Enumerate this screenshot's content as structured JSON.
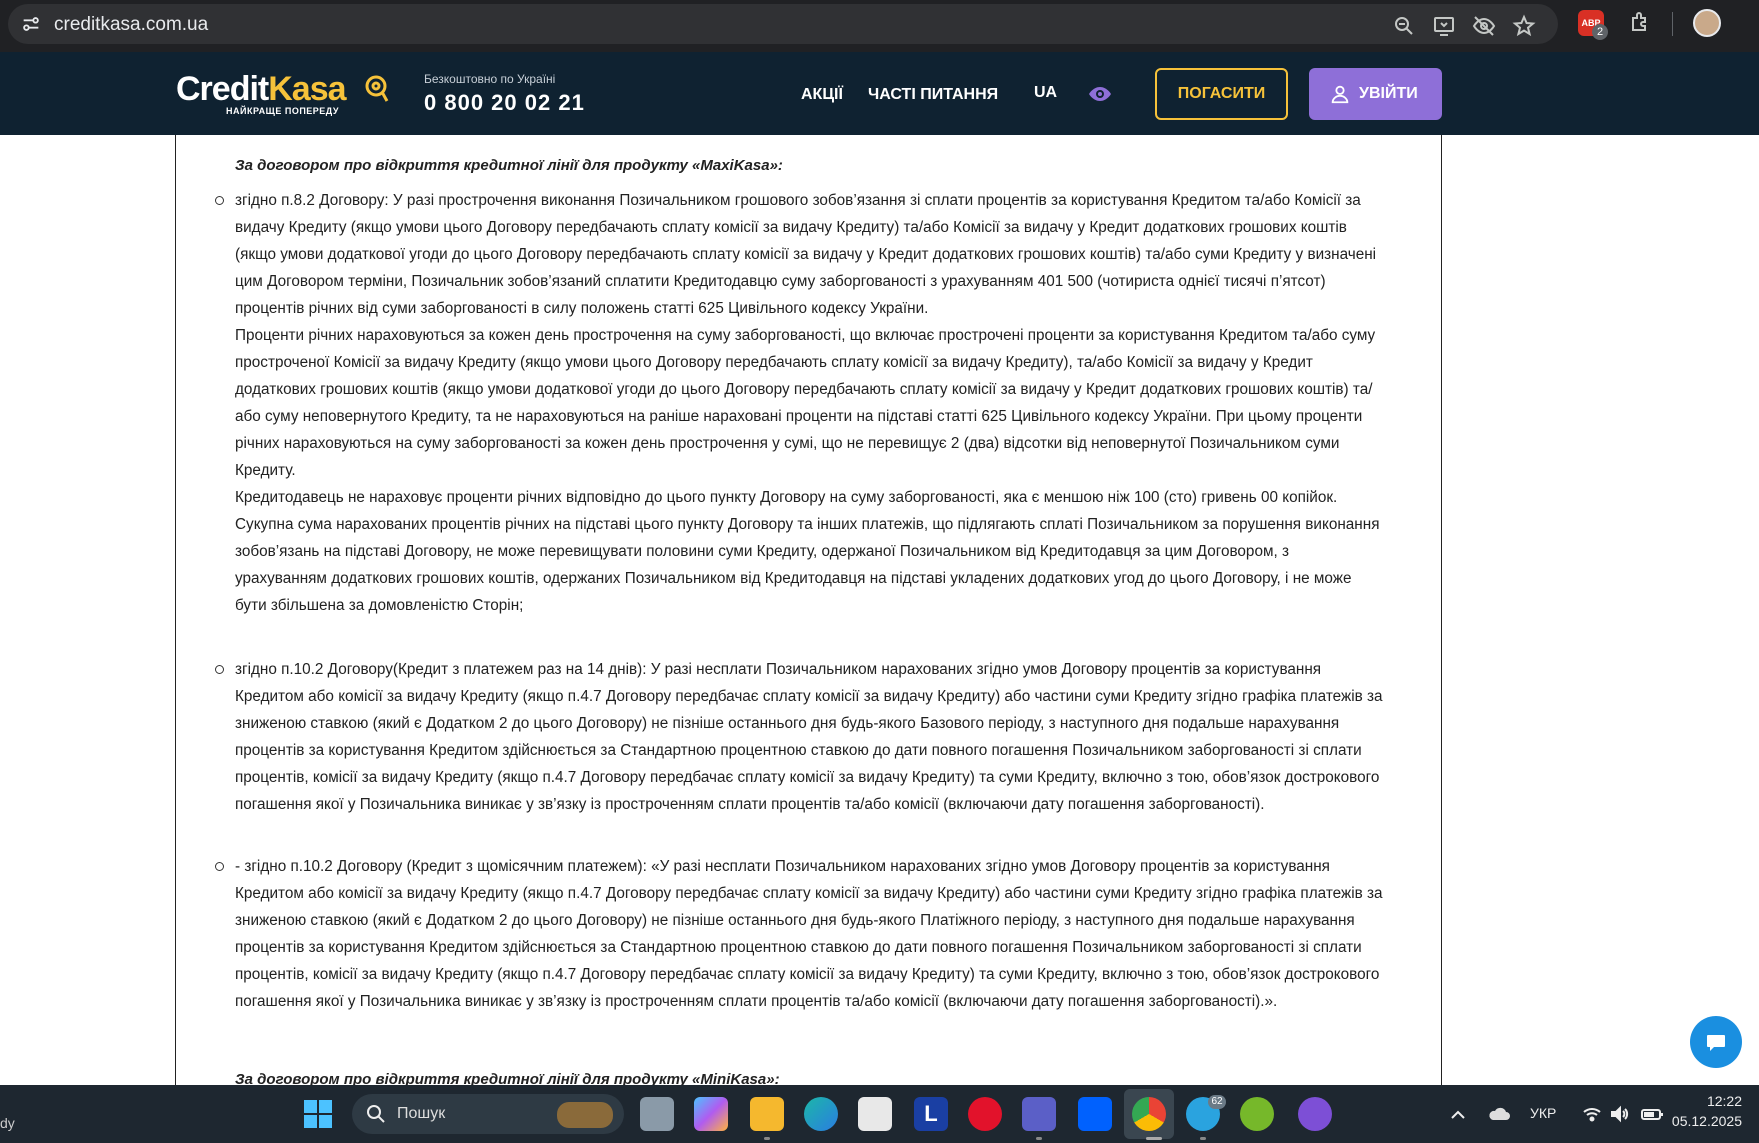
{
  "browser": {
    "url": "creditkasa.com.ua",
    "extension_badge_label": "ABP",
    "extension_count": "2"
  },
  "header": {
    "logo_credit": "Credit",
    "logo_kasa": "Kasa",
    "logo_tagline": "НАЙКРАЩЕ ПОПЕРЕДУ",
    "phone_caption": "Безкоштовно по Україні",
    "phone_number": "0 800 20 02 21",
    "nav": {
      "promotions": "АКЦІЇ",
      "faq": "ЧАСТІ ПИТАННЯ",
      "language": "UA"
    },
    "pay_button": "ПОГАСИТИ",
    "login_button": "УВІЙТИ",
    "colors": {
      "header_bg": "#0f2231",
      "accent_yellow": "#f6c23a",
      "accent_purple": "#8e6fd8"
    }
  },
  "content": {
    "heading_maxikasa": "За договором про відкриття кредитної лінії для продукту «MaxiKasa»:",
    "item1": {
      "p1": "згідно п.8.2 Договору: У разі прострочення виконання Позичальником грошового зобов’язання зі сплати процентів за користування Кредитом та/або Комісії за видачу Кредиту (якщо умови цього Договору передбачають сплату комісії за видачу Кредиту) та/або Комісії за видачу у Кредит додаткових грошових коштів (якщо умови додаткової угоди до цього Договору передбачають сплату комісії за видачу у Кредит додаткових грошових коштів) та/або суми Кредиту у визначені цим Договором терміни, Позичальник зобов’язаний сплатити Кредитодавцю суму заборгованості з урахуванням 401 500 (чотириста однієї тисячі п’ятсот) процентів річних від суми заборгованості в силу положень статті 625 Цивільного кодексу України.",
      "p2": "Проценти річних нараховуються за кожен день прострочення на суму заборгованості, що включає прострочені проценти за користування Кредитом та/або суму простроченої Комісії за видачу Кредиту (якщо умови цього Договору передбачають сплату комісії за видачу Кредиту), та/або Комісії за видачу у Кредит додаткових грошових коштів (якщо умови додаткової угоди до цього Договору передбачають сплату комісії за видачу у Кредит додаткових грошових коштів) та/або суму неповернутого Кредиту, та не нараховуються на раніше нараховані проценти на підставі статті 625 Цивільного кодексу України. При цьому проценти річних нараховуються на суму заборгованості за кожен день прострочення у сумі, що не перевищує 2 (два) відсотки від неповернутої Позичальником суми Кредиту.",
      "p3": "Кредитодавець не нараховує проценти річних відповідно до цього пункту Договору на суму заборгованості, яка є меншою ніж 100 (сто) гривень 00 копійок. Сукупна сума нарахованих процентів річних на підставі цього пункту Договору та інших платежів, що підлягають сплаті Позичальником за порушення виконання зобов’язань на підставі Договору, не може перевищувати половини суми Кредиту, одержаної Позичальником від Кредитодавця за цим Договором, з урахуванням додаткових грошових коштів, одержаних Позичальником від Кредитодавця на підставі укладених додаткових угод до цього Договору, і не може бути збільшена за домовленістю Сторін;"
    },
    "item2": "згідно п.10.2 Договору(Кредит з платежем раз на 14 днів): У разі несплати Позичальником нарахованих згідно умов Договору процентів за користування Кредитом або комісії за видачу Кредиту (якщо п.4.7 Договору передбачає сплату комісії за видачу Кредиту) або частини суми Кредиту згідно графіка платежів за зниженою ставкою (який є Додатком 2 до цього Договору) не пізніше останнього дня будь-якого Базового періоду, з наступного дня подальше нарахування процентів за користування Кредитом здійснюється за Стандартною процентною ставкою до дати повного погашення Позичальником заборгованості зі сплати процентів, комісії за видачу Кредиту (якщо п.4.7 Договору передбачає сплату комісії за видачу Кредиту) та суми Кредиту, включно з тою, обов’язок дострокового погашення якої у Позичальника виникає у зв’язку із простроченням сплати процентів та/або комісії (включаючи дату погашення заборгованості).",
    "item3": "- згідно п.10.2 Договору (Кредит з щомісячним платежем): «У разі несплати Позичальником нарахованих згідно умов Договору процентів за користування Кредитом або комісії за видачу Кредиту (якщо п.4.7 Договору передбачає сплату комісії за видачу Кредиту) або частини суми Кредиту згідно графіка платежів за зниженою ставкою (який є Додатком 2 до цього Договору) не пізніше останнього дня будь-якого Платіжного періоду, з наступного дня подальше нарахування процентів за користування Кредитом здійснюється за Стандартною процентною ставкою до дати повного погашення Позичальником заборгованості зі сплати процентів, комісії за видачу Кредиту (якщо п.4.7 Договору передбачає сплату комісії за видачу Кредиту) та суми Кредиту, включно з тою, обов’язок дострокового погашення якої у Позичальника виникає у зв’язку із простроченням сплати процентів та/або комісії (включаючи дату погашення заборгованості).».",
    "heading_minikasa_partial": "За договором про відкриття кредитної лінії для продукту «MiniKasa»:"
  },
  "taskbar": {
    "left_text": "dy",
    "search_placeholder": "Пошук",
    "language": "УКР",
    "time": "12:22",
    "date": "05.12.2025",
    "telegram_badge": "62",
    "icons": [
      "windows-start-icon",
      "file-explorer-icon",
      "copilot-icon",
      "folder-icon",
      "edge-icon",
      "store-icon",
      "l-app-icon",
      "opera-icon",
      "teams-icon",
      "dropbox-icon",
      "chrome-icon",
      "telegram-icon",
      "utorrent-icon",
      "viber-icon"
    ]
  }
}
